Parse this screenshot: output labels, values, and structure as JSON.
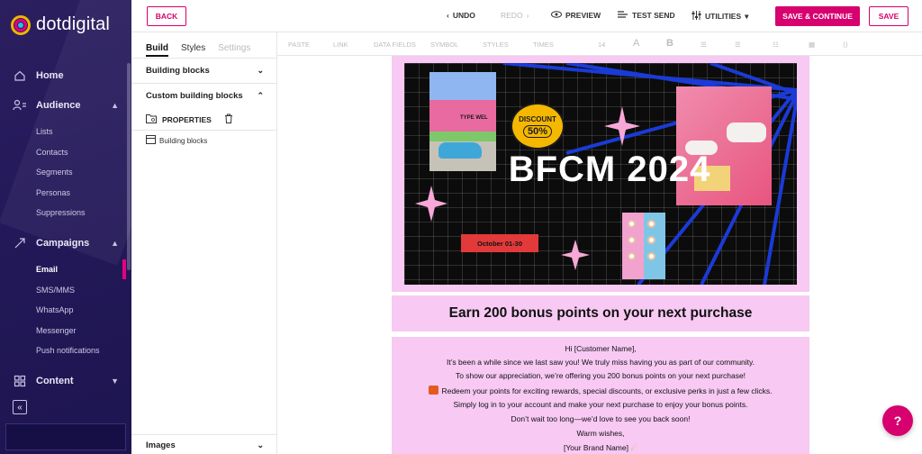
{
  "brand": {
    "name": "dotdigital",
    "accent": "#d6006f"
  },
  "sidebar": {
    "sections": [
      {
        "label": "Home",
        "icon": "home-icon"
      },
      {
        "label": "Audience",
        "icon": "audience-icon",
        "items": [
          "Lists",
          "Contacts",
          "Segments",
          "Personas",
          "Suppressions"
        ]
      },
      {
        "label": "Campaigns",
        "icon": "campaigns-icon",
        "items": [
          "Email",
          "SMS/MMS",
          "WhatsApp",
          "Messenger",
          "Push notifications"
        ],
        "active_item": "Email"
      },
      {
        "label": "Content",
        "icon": "content-icon"
      }
    ]
  },
  "topbar": {
    "back": "BACK",
    "undo": "UNDO",
    "redo": "REDO",
    "preview": "PREVIEW",
    "test_send": "TEST SEND",
    "utilities": "UTILITIES",
    "save_continue": "SAVE & CONTINUE",
    "save": "SAVE"
  },
  "panel": {
    "tabs": [
      "Build",
      "Styles",
      "Settings"
    ],
    "building_blocks": "Building blocks",
    "custom_blocks": "Custom building blocks",
    "properties": "PROPERTIES",
    "sub_item": "Building blocks",
    "images": "Images"
  },
  "format_toolbar": [
    "PASTE",
    "LINK",
    "DATA FIELDS",
    "SYMBOL",
    "STYLES",
    "TIMES",
    "14",
    "A",
    "B"
  ],
  "email": {
    "hero_title": "BFCM 2024",
    "discount_top": "DISCOUNT",
    "discount_value": "50%",
    "hero_shop_sign": "TYPE WEL",
    "date_range": "October 01-30",
    "headline": "Earn 200 bonus points on your next purchase",
    "body": [
      "Hi [Customer Name],",
      "It’s been a while since we last saw you! We truly miss having you as part of our community.",
      "To show our appreciation, we’re offering you 200 bonus points on your next purchase!",
      "Redeem your points for exciting rewards, special discounts, or exclusive perks in just a few clicks.",
      "Simply log in to your account and make your next purchase to enjoy your bonus points.",
      "Don’t wait too long—we’d love to see you back soon!",
      "Warm wishes,",
      "[Your Brand Name]"
    ]
  },
  "help": "?"
}
